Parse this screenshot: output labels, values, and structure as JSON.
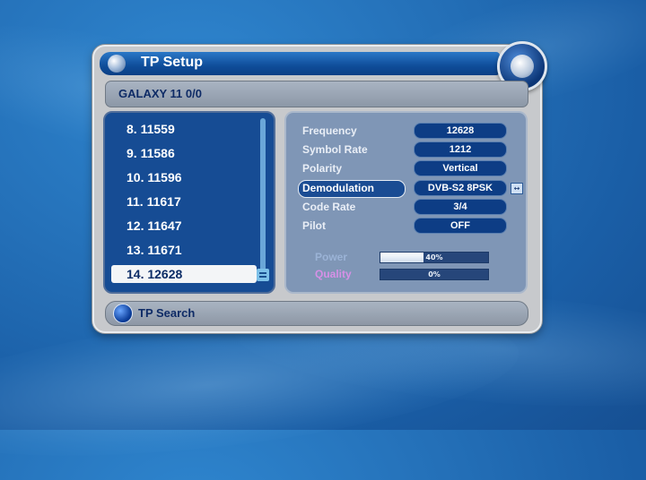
{
  "header": {
    "title": "TP Setup"
  },
  "satellite": {
    "name": "GALAXY 11  0/0"
  },
  "transponders": [
    "8. 11559",
    "9. 11586",
    "10. 11596",
    "11. 11617",
    "12. 11647",
    "13. 11671",
    "14. 12628"
  ],
  "selected_index": 6,
  "settings": [
    {
      "label": "Frequency",
      "value": "12628"
    },
    {
      "label": "Symbol Rate",
      "value": "1212"
    },
    {
      "label": "Polarity",
      "value": "Vertical"
    },
    {
      "label": "Demodulation",
      "value": "DVB-S2 8PSK",
      "active": true
    },
    {
      "label": "Code Rate",
      "value": "3/4"
    },
    {
      "label": "Pilot",
      "value": "OFF"
    }
  ],
  "signal": {
    "power_label": "Power",
    "power_value": "40%",
    "power_fraction": 0.4,
    "power_color": "#9bb3d6",
    "quality_label": "Quality",
    "quality_value": "0%",
    "quality_fraction": 0.0,
    "quality_color": "#d690e6"
  },
  "footer": {
    "button_label": "TP Search",
    "button_icon": "blue-button-icon"
  }
}
